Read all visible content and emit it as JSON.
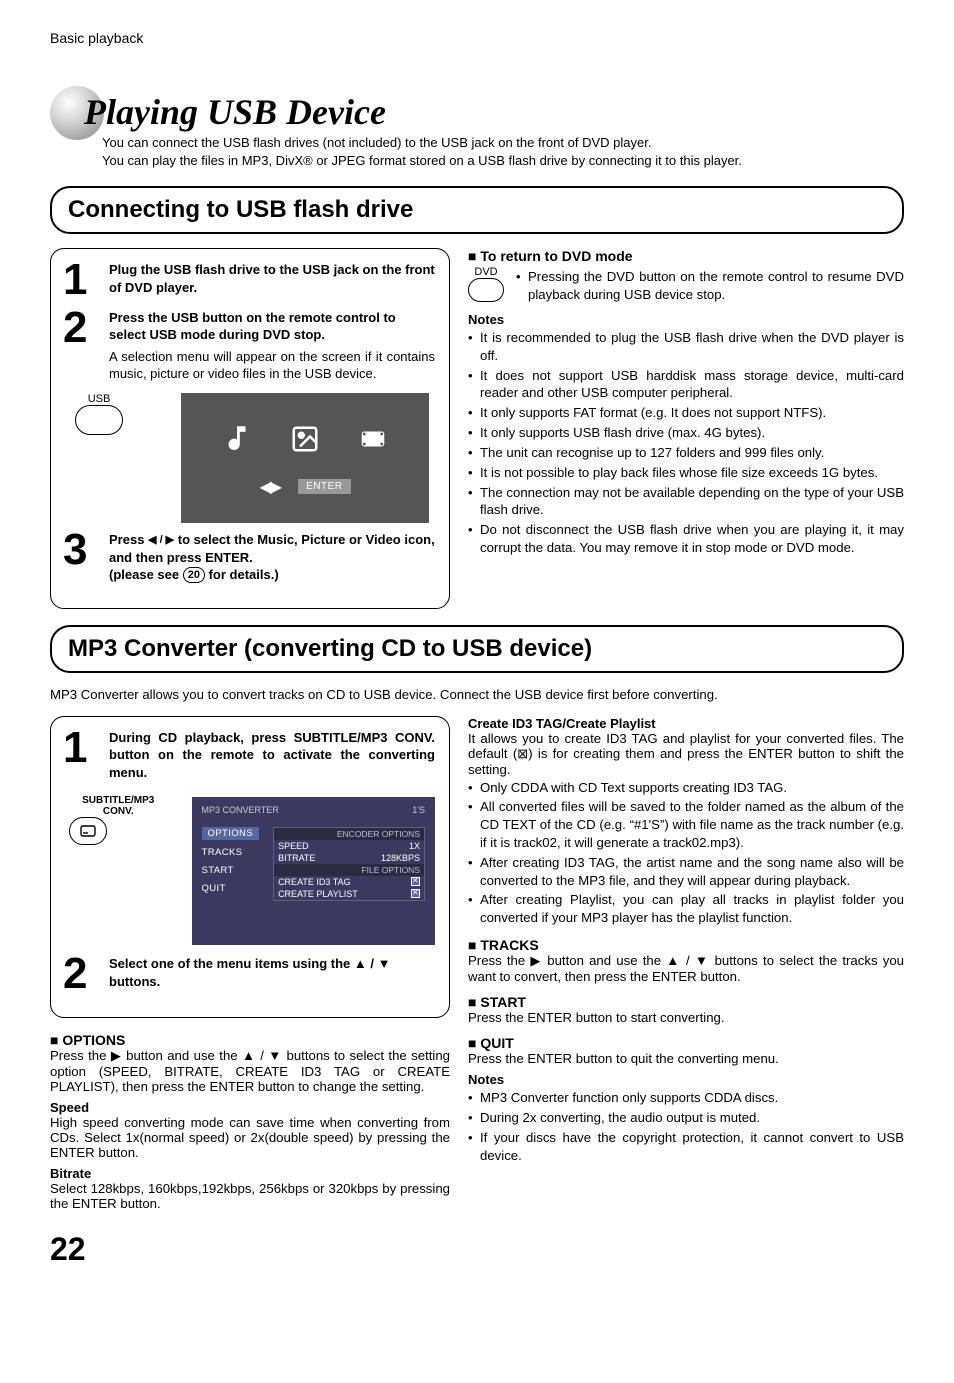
{
  "breadcrumb": "Basic playback",
  "page_title": "Playing USB Device",
  "intro": [
    "You can connect the USB flash drives (not included) to the USB jack on the front of DVD player.",
    "You can play the files in MP3, DivX® or JPEG format stored on a USB flash drive by connecting it to this player."
  ],
  "heading_connect": "Connecting to USB flash drive",
  "steps_connect": [
    {
      "num": "1",
      "title": "Plug the USB flash drive to the USB jack on the front of DVD player."
    },
    {
      "num": "2",
      "title": "Press the USB button on the remote control to select  USB mode during DVD stop.",
      "desc": "A selection menu will appear on the screen if it contains music, picture or video files in the USB device."
    },
    {
      "num": "3",
      "title_parts": {
        "a": "Press ",
        "b": " to select the Music, Picture or Video icon, and then press ENTER."
      },
      "arrows": "◀ / ▶",
      "subline_a": "(please see ",
      "subline_ref": "20",
      "subline_b": " for details.)"
    }
  ],
  "usb_button_label": "USB",
  "screen_enter": "ENTER",
  "return_dvd_h": "To return to DVD mode",
  "dvd_button_label": "DVD",
  "return_dvd_bullet": "Pressing the DVD button on the remote control to resume DVD playback during USB device stop.",
  "notes_h": "Notes",
  "notes_connect": [
    "It is recommended to plug the USB flash drive when the DVD player is off.",
    "It does not support USB harddisk mass storage device, multi-card reader and other USB computer peripheral.",
    "It only supports FAT format (e.g. It does not support NTFS).",
    "It only supports USB flash drive (max. 4G bytes).",
    "The unit can recognise up to 127 folders and 999 files only.",
    "It is not possible to play back files whose file size exceeds 1G bytes.",
    "The connection may not be available depending on the type of your USB flash drive.",
    "Do not disconnect the USB flash drive when you are playing it, it may corrupt the data. You may remove it in stop mode or DVD mode."
  ],
  "heading_mp3": "MP3 Converter (converting CD to USB device)",
  "mp3_intro": "MP3 Converter allows you to convert tracks on CD to USB device. Connect the USB device first before converting.",
  "steps_mp3": [
    {
      "num": "1",
      "title": "During CD playback, press SUBTITLE/MP3 CONV. button on the remote to activate the converting menu."
    },
    {
      "num": "2",
      "title_a": "Select one of the menu items using the ",
      "title_arrows": "▲ / ▼",
      "title_b": " buttons."
    }
  ],
  "subconv_label": "SUBTITLE/MP3 CONV.",
  "mp3_screen": {
    "top_left": "MP3 CONVERTER",
    "top_right": "1'S",
    "left_items": [
      "OPTIONS",
      "TRACKS",
      "START",
      "QUIT"
    ],
    "enc_h": "ENCODER OPTIONS",
    "rows_enc": [
      {
        "l": "SPEED",
        "r": "1X"
      },
      {
        "l": "BITRATE",
        "r": "128KBPS"
      }
    ],
    "file_h": "FILE OPTIONS",
    "rows_file": [
      "CREATE ID3 TAG",
      "CREATE PLAYLIST"
    ]
  },
  "options_h": "OPTIONS",
  "options_text": "Press the ▶ button and use the ▲ / ▼ buttons to select the setting option (SPEED, BITRATE, CREATE ID3 TAG or CREATE PLAYLIST), then press the ENTER button to change the setting.",
  "speed_h": "Speed",
  "speed_text": "High speed converting mode can save time when converting from CDs. Select 1x(normal speed) or 2x(double speed) by pressing the ENTER button.",
  "bitrate_h": "Bitrate",
  "bitrate_text": "Select 128kbps, 160kbps,192kbps, 256kbps or 320kbps by pressing the ENTER button.",
  "id3_h": "Create ID3 TAG/Create Playlist",
  "id3_text": "It allows you to create ID3 TAG and playlist for your converted files. The default (⊠) is for creating them and press the ENTER button to shift the setting.",
  "id3_bullets": [
    "Only CDDA with CD Text supports creating ID3 TAG.",
    "All converted files will be saved to the folder named as the album of the CD TEXT of the CD (e.g. “#1'S”) with file name as the track number (e.g. if it is track02, it will generate a track02.mp3).",
    "After creating ID3 TAG, the artist name and the song name also will be converted to the MP3 file, and they will appear during playback.",
    "After creating Playlist, you can play all tracks in playlist folder you converted if your MP3 player has the playlist function."
  ],
  "tracks_h": "TRACKS",
  "tracks_text": "Press the ▶ button and use the ▲ / ▼ buttons to select the tracks you want to convert, then press the ENTER button.",
  "start_h": "START",
  "start_text": "Press the ENTER button to start converting.",
  "quit_h": "QUIT",
  "quit_text": "Press the ENTER button to quit the converting menu.",
  "notes_mp3": [
    "MP3 Converter function only supports CDDA discs.",
    "During 2x converting, the audio output is muted.",
    "If your discs have the copyright protection, it cannot convert to USB device."
  ],
  "page_number": "22"
}
